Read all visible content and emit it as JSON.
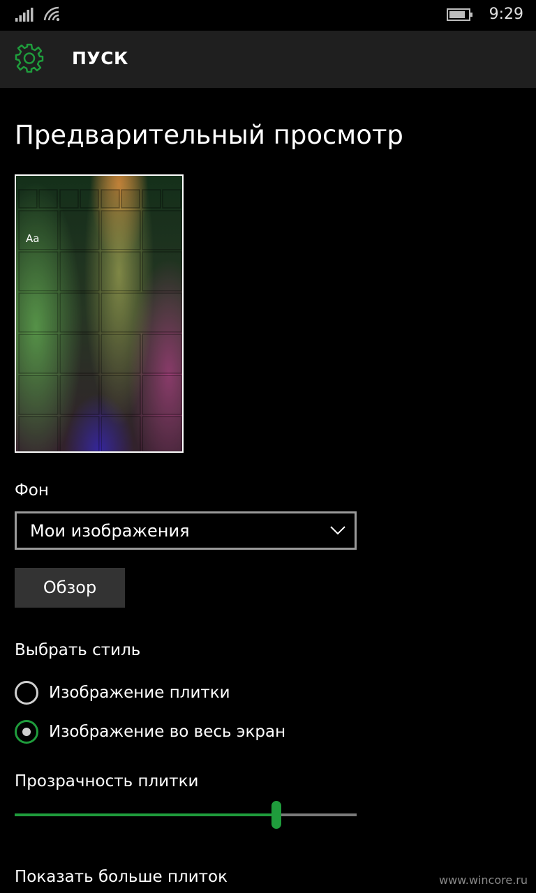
{
  "status_bar": {
    "time": "9:29",
    "icons": [
      "signal-icon",
      "wifi-icon",
      "battery-icon"
    ]
  },
  "header": {
    "title": "ПУСК",
    "icon": "gear-icon",
    "accent_color": "#1f9c3c"
  },
  "preview": {
    "heading": "Предварительный просмотр",
    "sample_text": "Aa"
  },
  "background": {
    "label": "Фон",
    "selected": "Мои изображения",
    "browse_label": "Обзор"
  },
  "style": {
    "label": "Выбрать стиль",
    "options": [
      {
        "label": "Изображение плитки",
        "checked": false
      },
      {
        "label": "Изображение во весь экран",
        "checked": true
      }
    ]
  },
  "transparency": {
    "label": "Прозрачность плитки",
    "value_fraction": 0.765
  },
  "more_tiles": {
    "label": "Показать больше плиток"
  },
  "watermark": "www.wincore.ru"
}
